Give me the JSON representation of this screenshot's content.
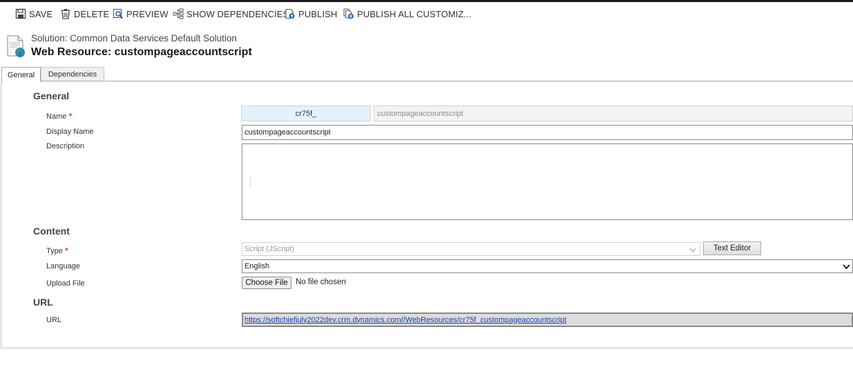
{
  "toolbar": {
    "save": "SAVE",
    "delete": "DELETE",
    "preview": "PREVIEW",
    "show_dependencies": "SHOW DEPENDENCIES",
    "publish": "PUBLISH",
    "publish_all": "PUBLISH ALL CUSTOMIZ..."
  },
  "header": {
    "subtitle": "Solution: Common Data Services Default Solution",
    "title": "Web Resource: custompageaccountscript",
    "icon": "web-resource-document-globe-icon"
  },
  "tabs": [
    {
      "label": "General",
      "active": true
    },
    {
      "label": "Dependencies",
      "active": false
    }
  ],
  "general": {
    "heading": "General",
    "name_label": "Name",
    "name_prefix": "cr75f_",
    "name_value": "custompageaccountscript",
    "display_name_label": "Display Name",
    "display_name_value": "custompageaccountscript",
    "description_label": "Description",
    "description_value": ""
  },
  "content": {
    "heading": "Content",
    "type_label": "Type",
    "type_value": "Script (JScript)",
    "text_editor_label": "Text Editor",
    "language_label": "Language",
    "language_value": "English",
    "upload_label": "Upload File",
    "choose_file_label": "Choose File",
    "no_file_text": "No file chosen"
  },
  "url": {
    "heading": "URL",
    "url_label": "URL",
    "url_value": "https://softchiefjuly2022dev.crm.dynamics.com//WebResources/cr75f_custompageaccountscript"
  },
  "required_marker": "*",
  "colors": {
    "required": "#c00000",
    "link": "#1a3fb0",
    "prefix_bg": "#e7f1fb"
  }
}
